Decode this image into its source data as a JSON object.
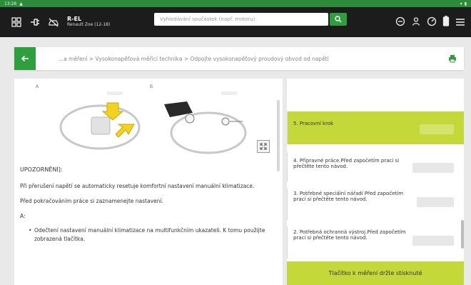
{
  "status": {
    "time": "13:26"
  },
  "appbar": {
    "vehicle_code": "R-EL",
    "vehicle_model": "Renault Zoe (12-18)",
    "search_placeholder": "Vyhledávání součástek (např. motoru)"
  },
  "breadcrumb": {
    "text": "...a měření > Vysokonapěťová měřicí technika > Odpojte vysokonapěťový proudový obvod od napětí"
  },
  "figure": {
    "label_a": "A",
    "label_b": "B"
  },
  "content": {
    "warning_title": "UPOZORNĚNÍ]:",
    "para1": "Při přerušení napětí se automaticky resetuje komfortní nastavení manuální klimatizace.",
    "para2": "Před pokračováním práce si zaznamenejte nastavení.",
    "section": "A:",
    "bullet1": "Odečtení nastavení manuální klimatizace na multifunkčním ukazateli. K tomu použijte zobrazená tlačítka."
  },
  "steps": [
    {
      "label": "5. Pracovní krok",
      "active": true
    },
    {
      "label": "4. Přípravné práce.Před započetím prací si přečtěte tento návod.",
      "active": false
    },
    {
      "label": "3. Potřebné speciální nářadí Před započetím prací si přečtěte tento návod.",
      "active": false
    },
    {
      "label": "2. Potřebná ochranná výstroj.Před započetím prací si přečtěte tento návod.",
      "active": false
    }
  ],
  "bottom_button": "Tlačítko k měření držte stisknuté",
  "colors": {
    "accent_green": "#2e9e3e",
    "step_yellow": "#c4d83a",
    "appbar": "#1c1c1c"
  }
}
